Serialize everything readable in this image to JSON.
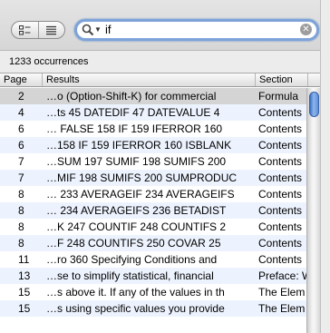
{
  "search": {
    "query": "if"
  },
  "occurrences_label": "1233 occurrences",
  "table": {
    "columns": [
      "Page",
      "Results",
      "Section"
    ],
    "rows": [
      {
        "page": "2",
        "result": "…o (Option-Shift-K) for commercial",
        "section": "Formula"
      },
      {
        "page": "4",
        "result": "…ts  45 DATEDIF  47 DATEVALUE  4",
        "section": "Contents"
      },
      {
        "page": "6",
        "result": "… FALSE  158 IF  159 IFERROR  160",
        "section": "Contents"
      },
      {
        "page": "6",
        "result": "…158 IF  159 IFERROR  160 ISBLANK",
        "section": "Contents"
      },
      {
        "page": "7",
        "result": "…SUM  197 SUMIF  198 SUMIFS  200",
        "section": "Contents"
      },
      {
        "page": "7",
        "result": "…MIF  198 SUMIFS  200 SUMPRODUC",
        "section": "Contents"
      },
      {
        "page": "8",
        "result": "… 233 AVERAGEIF  234 AVERAGEIFS",
        "section": "Contents"
      },
      {
        "page": "8",
        "result": "… 234 AVERAGEIFS  236 BETADIST",
        "section": "Contents"
      },
      {
        "page": "8",
        "result": "…K  247 COUNTIF  248 COUNTIFS  2",
        "section": "Contents"
      },
      {
        "page": "8",
        "result": "…F  248 COUNTIFS  250 COVAR  25",
        "section": "Contents"
      },
      {
        "page": "11",
        "result": "…ro  360 Specifying Conditions and",
        "section": "Contents"
      },
      {
        "page": "13",
        "result": "…se  to simplify statistical, financial",
        "section": "Preface: W"
      },
      {
        "page": "15",
        "result": "…s above it. If any of the values in th",
        "section": "The Elem"
      },
      {
        "page": "15",
        "result": "…s using specific values you provide",
        "section": "The Elem"
      }
    ]
  }
}
